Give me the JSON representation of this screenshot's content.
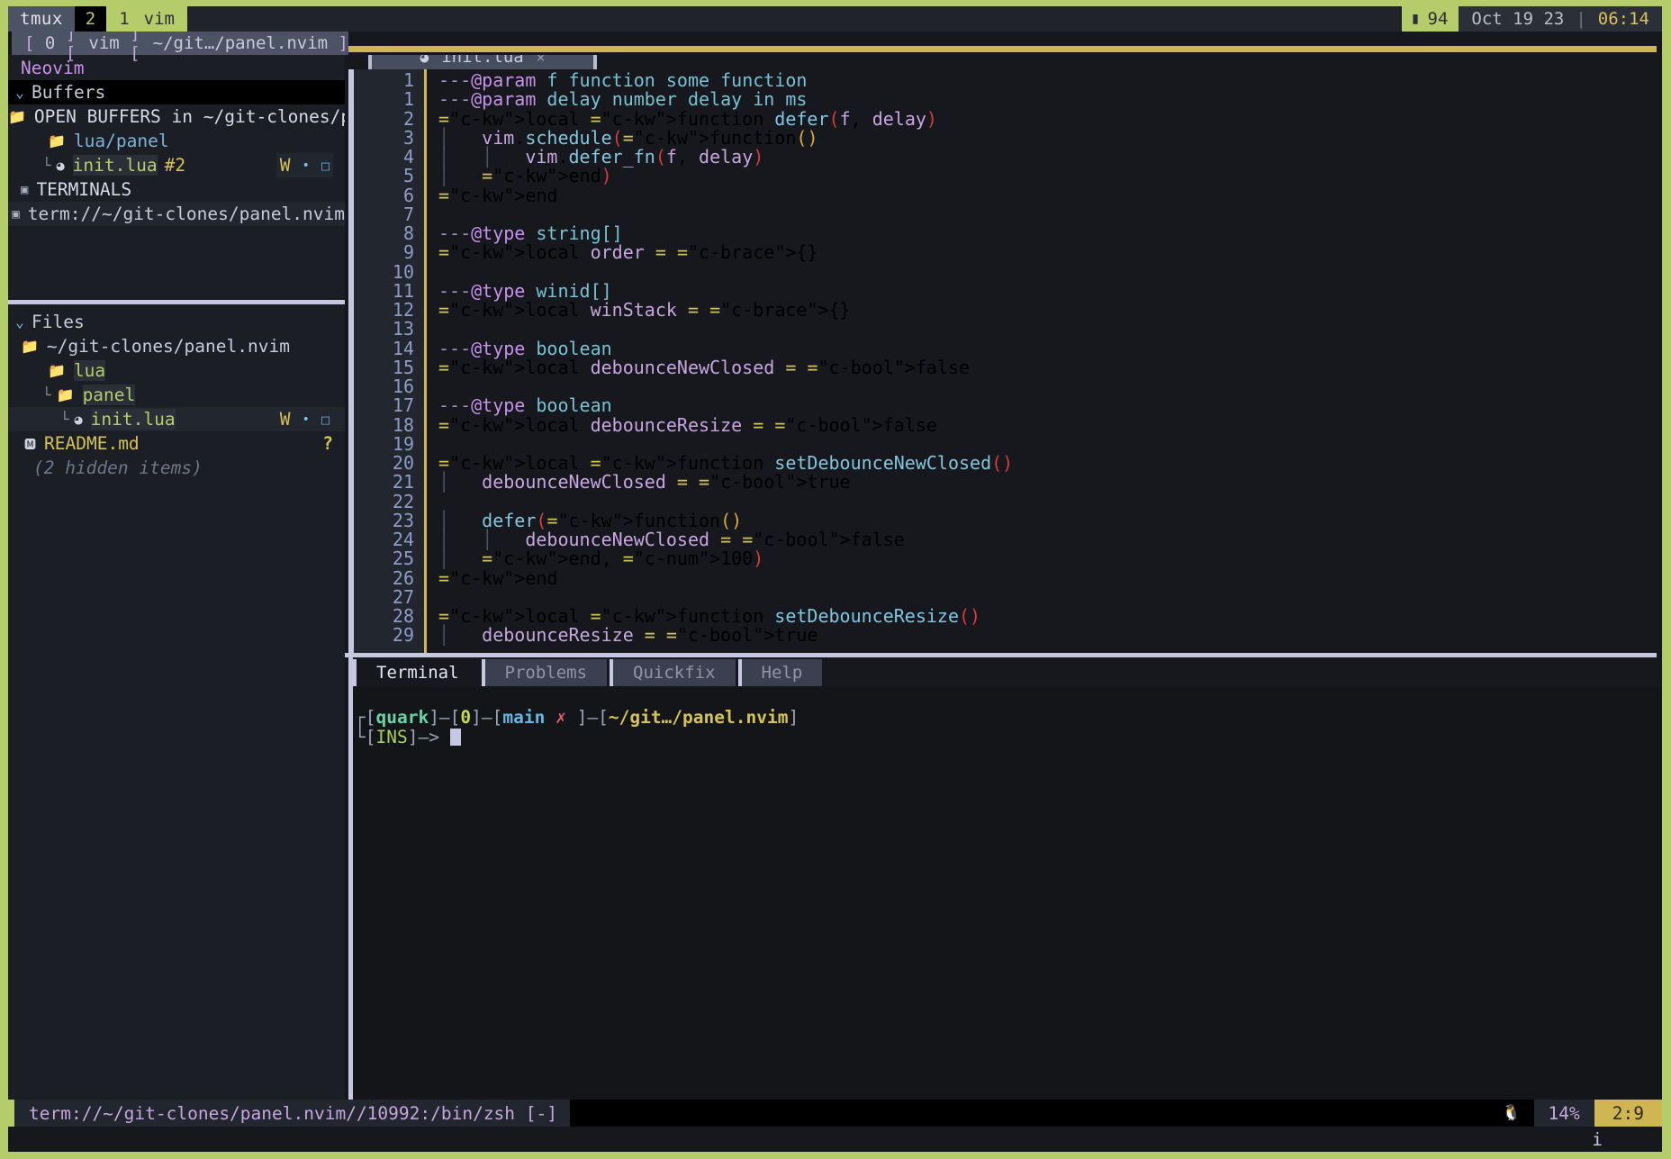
{
  "tmux": {
    "prefix_label": "tmux",
    "window_index": "2",
    "active_window_index": "1",
    "active_window_name": "vim",
    "battery_icon": "battery-icon",
    "battery_level": "94",
    "date": "Oct 19 23",
    "separator": "|",
    "clock": "06:14"
  },
  "window_title": {
    "full": "[ 0 ][ vim ][ ~/git…/panel.nvim ]",
    "left_bracket": "[",
    "zero": "0",
    "mid": "][",
    "app": "vim",
    "path": "~/git…/panel.nvim",
    "right_bracket": "]"
  },
  "sidebar": {
    "buffers": {
      "plugin_title": "Neovim",
      "section_label": "Buffers",
      "chevron_icon": "chevron-down-icon",
      "groups": [
        {
          "label": "OPEN BUFFERS in ~/git-clones/pan",
          "icon": "folder-icon"
        }
      ],
      "items": [
        {
          "label": "lua/panel",
          "icon": "folder-icon",
          "indent": 2
        },
        {
          "label": "init.lua",
          "buf_number": "#2",
          "icon": "lua-file-icon",
          "indent": 3,
          "flags": {
            "modified": "W",
            "dot": "•",
            "window": "□"
          }
        }
      ],
      "terminals_label": "TERMINALS",
      "terminals_icon": "terminal-icon",
      "terminals": [
        {
          "label": "term://~/git-clones/panel.nvim",
          "icon": "terminal-icon"
        }
      ]
    },
    "files": {
      "section_label": "Files",
      "chevron_icon": "chevron-down-icon",
      "root": "~/git-clones/panel.nvim",
      "tree": [
        {
          "label": "lua",
          "icon": "folder-icon",
          "indent": 2,
          "kind": "folder-open"
        },
        {
          "label": "panel",
          "icon": "folder-icon",
          "indent": 3,
          "kind": "folder-open"
        },
        {
          "label": "init.lua",
          "icon": "lua-file-icon",
          "indent": 4,
          "kind": "file-selected",
          "flags": {
            "modified": "W",
            "dot": "•",
            "window": "□"
          }
        },
        {
          "label": "README.md",
          "icon": "markdown-icon",
          "indent": 2,
          "kind": "file",
          "flags": {
            "status": "?"
          }
        }
      ],
      "hidden_note": "(2 hidden items)"
    }
  },
  "editor": {
    "tab": {
      "icon": "lua-file-icon",
      "label": "init.lua",
      "close_icon": "×"
    },
    "line_numbers": [
      "1",
      "1",
      "2",
      "3",
      "4",
      "5",
      "6",
      "7",
      "8",
      "9",
      "10",
      "11",
      "12",
      "13",
      "14",
      "15",
      "16",
      "17",
      "18",
      "19",
      "20",
      "21",
      "22",
      "23",
      "24",
      "25",
      "26",
      "27",
      "28",
      "29"
    ],
    "lines": [
      "---@param f function some function",
      "---@param delay number delay in ms",
      "local function defer(f, delay)",
      "    vim.schedule(function()",
      "        vim.defer_fn(f, delay)",
      "    end)",
      "end",
      "",
      "---@type string[]",
      "local order = {}",
      "",
      "---@type winid[]",
      "local winStack = {}",
      "",
      "---@type boolean",
      "local debounceNewClosed = false",
      "",
      "---@type boolean",
      "local debounceResize = false",
      "",
      "local function setDebounceNewClosed()",
      "    debounceNewClosed = true",
      "",
      "    defer(function()",
      "        debounceNewClosed = false",
      "    end, 100)",
      "end",
      "",
      "local function setDebounceResize()",
      "    debounceResize = true"
    ]
  },
  "panel": {
    "tabs": [
      {
        "label": "Terminal",
        "active": true
      },
      {
        "label": "Problems",
        "active": false
      },
      {
        "label": "Quickfix",
        "active": false
      },
      {
        "label": "Help",
        "active": false
      }
    ],
    "terminal": {
      "prompt_line": {
        "host": "quark",
        "exit_code": "0",
        "branch": "main",
        "dirty_marker": "✗",
        "cwd": "~/git…/panel.nvim"
      },
      "input_line": {
        "mode": "INS",
        "arrow": "–>",
        "value": ""
      }
    }
  },
  "statusline": {
    "buffer_name": "term://~/git-clones/panel.nvim//10992:/bin/zsh [-]",
    "os_icon": "linux-penguin-icon",
    "percent": "14%",
    "position": "2:9",
    "mode_indicator": "i"
  },
  "colors": {
    "accent_green": "#b5cc6a",
    "accent_yellow": "#d0b652",
    "bg": "#16181d",
    "bg_alt": "#22262e",
    "divider": "#c5c8e0",
    "purple": "#c792ea"
  }
}
